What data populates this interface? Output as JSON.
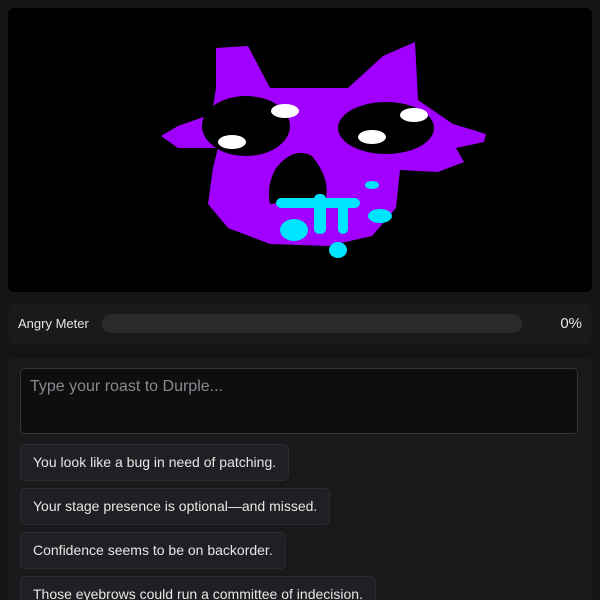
{
  "character": {
    "name": "Durple",
    "colors": {
      "body": "#a100ff",
      "eyes": "#000000",
      "eye_glint": "#ffffff",
      "drool": "#00e5ff",
      "background": "#000000"
    }
  },
  "meter": {
    "label": "Angry Meter",
    "value_text": "0%",
    "value": 0,
    "fill_color": "#c8282f"
  },
  "input": {
    "placeholder": "Type your roast to Durple...",
    "value": ""
  },
  "suggestions": [
    {
      "label": "You look like a bug in need of patching."
    },
    {
      "label": "Your stage presence is optional—and missed."
    },
    {
      "label": "Confidence seems to be on backorder."
    },
    {
      "label": "Those eyebrows could run a committee of indecision."
    }
  ]
}
